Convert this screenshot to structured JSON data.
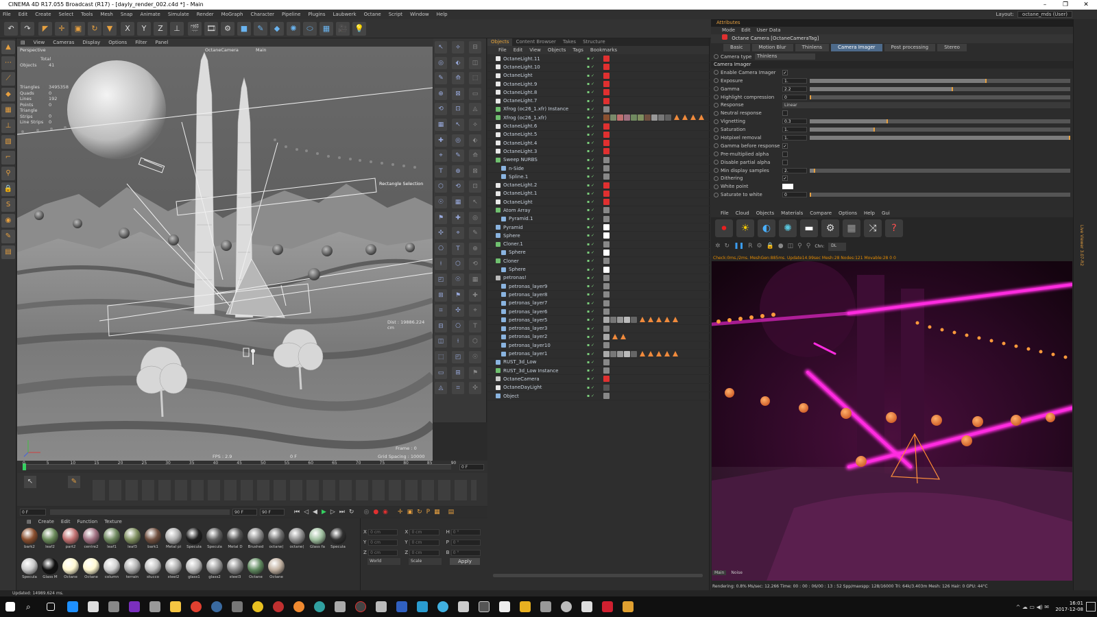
{
  "window": {
    "title": "CINEMA 4D R17.055 Broadcast (R17) - [dayly_render_002.c4d *] - Main",
    "controls": [
      "–",
      "❐",
      "✕"
    ]
  },
  "menubar": [
    "File",
    "Edit",
    "Create",
    "Select",
    "Tools",
    "Mesh",
    "Snap",
    "Animate",
    "Simulate",
    "Render",
    "MoGraph",
    "Character",
    "Pipeline",
    "Plugins",
    "Laubwerk",
    "Octane",
    "Script",
    "Window",
    "Help"
  ],
  "layout": {
    "label": "Layout:",
    "value": "octane_mds (User)"
  },
  "toolbar_icons": [
    "undo-icon",
    "redo-icon",
    "live-select-icon",
    "move-icon",
    "scale-icon",
    "rotate-icon",
    "recent-tools-icon",
    "x-axis-icon",
    "y-axis-icon",
    "z-axis-icon",
    "coordinate-system-icon",
    "render-view-icon",
    "render-picture-viewer-icon",
    "render-settings-icon",
    "cube-icon",
    "pen-icon",
    "subdivision-icon",
    "array-icon",
    "deformer-icon",
    "floor-icon",
    "camera-icon",
    "light-icon"
  ],
  "toolbar_glyphs": [
    "↶",
    "↷",
    "◤",
    "✛",
    "▣",
    "↻",
    "▼",
    "X",
    "Y",
    "Z",
    "⊥",
    "🎬",
    "🎞",
    "⚙",
    "■",
    "✎",
    "◆",
    "✺",
    "⬭",
    "▦",
    "🎥",
    "💡"
  ],
  "viewport": {
    "menu": [
      "View",
      "Cameras",
      "Display",
      "Options",
      "Filter",
      "Panel"
    ],
    "label": "Perspective",
    "camera_tag": "OctaneCamera",
    "main_tag": "Main",
    "stats_title": "Total",
    "stats": [
      {
        "k": "Objects",
        "v": "41"
      },
      {
        "k": "Triangles",
        "v": "3495358"
      },
      {
        "k": "Quads",
        "v": "0"
      },
      {
        "k": "Lines",
        "v": "192"
      },
      {
        "k": "Points",
        "v": "0"
      },
      {
        "k": "Triangle Strips",
        "v": "0"
      },
      {
        "k": "Line Strips",
        "v": "0"
      }
    ],
    "selection_label": "Rectangle Selection",
    "dist": "Dist : 19886.224 cm",
    "frame": "Frame : 0",
    "fps": "FPS : 2.9",
    "frame_mid": "0 F",
    "grid": "Grid Spacing : 10000 cm"
  },
  "object_manager": {
    "tabs": [
      "Objects",
      "Content Browser",
      "Takes",
      "Structure"
    ],
    "menu": [
      "File",
      "Edit",
      "View",
      "Objects",
      "Tags",
      "Bookmarks"
    ],
    "items": [
      {
        "name": "OctaneLight.11",
        "indent": 0,
        "color": "#e8e8e8"
      },
      {
        "name": "OctaneLight.10",
        "indent": 0,
        "color": "#e8e8e8"
      },
      {
        "name": "OctaneLight",
        "indent": 0,
        "color": "#e8e8e8"
      },
      {
        "name": "OctaneLight.9",
        "indent": 0,
        "color": "#e8e8e8"
      },
      {
        "name": "OctaneLight.8",
        "indent": 0,
        "color": "#e8e8e8"
      },
      {
        "name": "OctaneLight.7",
        "indent": 0,
        "color": "#e8e8e8"
      },
      {
        "name": "Xfrog (oc26_1.xfr) Instance",
        "indent": 0,
        "color": "#6fc06f"
      },
      {
        "name": "Xfrog (oc26_1.xfr)",
        "indent": 0,
        "color": "#6fc06f"
      },
      {
        "name": "OctaneLight.6",
        "indent": 0,
        "color": "#e8e8e8"
      },
      {
        "name": "OctaneLight.5",
        "indent": 0,
        "color": "#e8e8e8"
      },
      {
        "name": "OctaneLight.4",
        "indent": 0,
        "color": "#e8e8e8"
      },
      {
        "name": "OctaneLight.3",
        "indent": 0,
        "color": "#e8e8e8"
      },
      {
        "name": "Sweep NURBS",
        "indent": 0,
        "color": "#6fc06f"
      },
      {
        "name": "n-Side",
        "indent": 1,
        "color": "#8ab4e0"
      },
      {
        "name": "Spline.1",
        "indent": 1,
        "color": "#8ab4e0"
      },
      {
        "name": "OctaneLight.2",
        "indent": 0,
        "color": "#e8e8e8"
      },
      {
        "name": "OctaneLight.1",
        "indent": 0,
        "color": "#e8e8e8"
      },
      {
        "name": "OctaneLight",
        "indent": 0,
        "color": "#e8e8e8"
      },
      {
        "name": "Atom Array",
        "indent": 0,
        "color": "#6fc06f"
      },
      {
        "name": "Pyramid.1",
        "indent": 1,
        "color": "#8ab4e0"
      },
      {
        "name": "Pyramid",
        "indent": 0,
        "color": "#8ab4e0"
      },
      {
        "name": "Sphere",
        "indent": 0,
        "color": "#8ab4e0"
      },
      {
        "name": "Cloner.1",
        "indent": 0,
        "color": "#6fc06f"
      },
      {
        "name": "Sphere",
        "indent": 1,
        "color": "#8ab4e0"
      },
      {
        "name": "Cloner",
        "indent": 0,
        "color": "#6fc06f"
      },
      {
        "name": "Sphere",
        "indent": 1,
        "color": "#8ab4e0"
      },
      {
        "name": "petronas!",
        "indent": 0,
        "color": "#bbbbbb"
      },
      {
        "name": "petronas_layer9",
        "indent": 1,
        "color": "#8ab4e0"
      },
      {
        "name": "petronas_layer8",
        "indent": 1,
        "color": "#8ab4e0"
      },
      {
        "name": "petronas_layer7",
        "indent": 1,
        "color": "#8ab4e0"
      },
      {
        "name": "petronas_layer6",
        "indent": 1,
        "color": "#8ab4e0"
      },
      {
        "name": "petronas_layer5",
        "indent": 1,
        "color": "#8ab4e0"
      },
      {
        "name": "petronas_layer3",
        "indent": 1,
        "color": "#8ab4e0"
      },
      {
        "name": "petronas_layer2",
        "indent": 1,
        "color": "#8ab4e0"
      },
      {
        "name": "petronas_layer10",
        "indent": 1,
        "color": "#8ab4e0"
      },
      {
        "name": "petronas_layer1",
        "indent": 1,
        "color": "#8ab4e0"
      },
      {
        "name": "RUST_3d_Low",
        "indent": 0,
        "color": "#8ab4e0"
      },
      {
        "name": "RUST_3d_Low Instance",
        "indent": 0,
        "color": "#6fc06f"
      },
      {
        "name": "OctaneCamera",
        "indent": 0,
        "color": "#cccccc"
      },
      {
        "name": "OctaneDayLight",
        "indent": 0,
        "color": "#e8e8e8"
      },
      {
        "name": "Object",
        "indent": 0,
        "color": "#8ab4e0"
      }
    ]
  },
  "attributes": {
    "header": "Attributes",
    "menu": [
      "Mode",
      "Edit",
      "User Data"
    ],
    "object": "Octane Camera [OctaneCameraTag]",
    "tabs": [
      "Basic",
      "Motion Blur",
      "Thinlens",
      "Camera Imager",
      "Post processing",
      "Stereo"
    ],
    "active_tab": "Camera Imager",
    "camera_type_label": "Camera type",
    "camera_type": "Thinlens",
    "section": "Camera Imager",
    "rows": [
      {
        "label": "Enable Camera Imager",
        "value": "✓",
        "kind": "check"
      },
      {
        "label": "Exposure",
        "value": "1.",
        "kind": "slider",
        "fill": 0.68
      },
      {
        "label": "Gamma",
        "value": "2.2",
        "kind": "slider",
        "fill": 0.55
      },
      {
        "label": "Highlight compression",
        "value": "0",
        "kind": "slider",
        "fill": 0.0
      },
      {
        "label": "Response",
        "value": "Linear",
        "kind": "select"
      },
      {
        "label": "Neutral response",
        "value": "",
        "kind": "check"
      },
      {
        "label": "Vignetting",
        "value": "0.3",
        "kind": "slider",
        "fill": 0.3
      },
      {
        "label": "Saturation",
        "value": "1.",
        "kind": "slider",
        "fill": 0.25
      },
      {
        "label": "Hotpixel removal",
        "value": "1.",
        "kind": "slider",
        "fill": 1.0
      },
      {
        "label": "Gamma before response",
        "value": "✓",
        "kind": "check"
      },
      {
        "label": "Pre-multiplied alpha",
        "value": "",
        "kind": "check"
      },
      {
        "label": "Disable partial alpha",
        "value": "",
        "kind": "check"
      },
      {
        "label": "Min display samples",
        "value": "2.",
        "kind": "slider",
        "fill": 0.02
      },
      {
        "label": "Dithering",
        "value": "✓",
        "kind": "check"
      },
      {
        "label": "White point",
        "value": "",
        "kind": "color"
      },
      {
        "label": "Saturate to white",
        "value": "0",
        "kind": "slider",
        "fill": 0.0
      }
    ]
  },
  "octane": {
    "menu": [
      "File",
      "Cloud",
      "Objects",
      "Materials",
      "Compare",
      "Options",
      "Help",
      "Gui"
    ],
    "buttons": [
      {
        "icon": "record-icon",
        "glyph": "⏺",
        "color": "#e82020"
      },
      {
        "icon": "sun-icon",
        "glyph": "☀",
        "color": "#ffd000"
      },
      {
        "icon": "contrast-icon",
        "glyph": "◐",
        "color": "#4ab0ff"
      },
      {
        "icon": "octane-logo-icon",
        "glyph": "✺",
        "color": "#5ac8e0"
      },
      {
        "icon": "white-bar-icon",
        "glyph": "▬",
        "color": "#ffffff"
      },
      {
        "icon": "settings-icon",
        "glyph": "⚙",
        "color": "#dddddd"
      },
      {
        "icon": "grid-icon",
        "glyph": "▦",
        "color": "#999999"
      },
      {
        "icon": "shuffle-icon",
        "glyph": "⤨",
        "color": "#dddddd"
      },
      {
        "icon": "help-icon",
        "glyph": "?",
        "color": "#ff5050"
      }
    ],
    "channel_label": "Chn:",
    "channel": "DL",
    "info": "Check:0ms./2ms. MeshGen:885ms. Update14.99sec Mesh:28 Nodes:121 Movable:28  0 0",
    "tabs": [
      "Main",
      "Noise"
    ],
    "status": "Rendering: 0.8%   Ms/sec: 12.266   Time: 00 : 00 : 06/00 : 13 : 52   Spp/maxspp: 128/16000   Tri: 64k/3.403m   Mesh: 126   Hair: 0   GPU:   44°C"
  },
  "timeline": {
    "ticks": [
      "0",
      "5",
      "10",
      "15",
      "20",
      "25",
      "30",
      "35",
      "40",
      "45",
      "50",
      "55",
      "60",
      "65",
      "70",
      "75",
      "80",
      "85",
      "90"
    ],
    "current": "0 F",
    "start": "0 F",
    "end": "90 F",
    "end2": "90 F"
  },
  "materials": {
    "menu": [
      "Create",
      "Edit",
      "Function",
      "Texture"
    ],
    "row1": [
      {
        "n": "bark2",
        "c": "#8a5030"
      },
      {
        "n": "leaf2",
        "c": "#6a8a5a"
      },
      {
        "n": "part2",
        "c": "#c07070"
      },
      {
        "n": "centre2",
        "c": "#a07080"
      },
      {
        "n": "leaf1",
        "c": "#708a60"
      },
      {
        "n": "leaf3",
        "c": "#809060"
      },
      {
        "n": "bark1",
        "c": "#705040"
      },
      {
        "n": "Metal pi",
        "c": "#b0b0b0"
      },
      {
        "n": "Specula",
        "c": "#202020"
      },
      {
        "n": "Specula",
        "c": "#606060"
      },
      {
        "n": "Metal D",
        "c": "#555"
      },
      {
        "n": "Brushed",
        "c": "#8a8a8a"
      },
      {
        "n": "octane(",
        "c": "#707070"
      },
      {
        "n": "octane(",
        "c": "#909090"
      },
      {
        "n": "Glass fa",
        "c": "#a0c0a0"
      },
      {
        "n": "Specula",
        "c": "#303030"
      }
    ],
    "row2": [
      {
        "n": "Specula",
        "c": "#c8c8c8"
      },
      {
        "n": "Glass M",
        "c": "#111"
      },
      {
        "n": "Octane",
        "c": "#fff8d0"
      },
      {
        "n": "Octane",
        "c": "#fff8d0"
      },
      {
        "n": "column",
        "c": "#d0d0d0"
      },
      {
        "n": "terrain",
        "c": "#b0b0b0"
      },
      {
        "n": "stucco",
        "c": "#c0c0c0"
      },
      {
        "n": "steel2",
        "c": "#aaaaaa"
      },
      {
        "n": "glass1",
        "c": "#bbbbbb"
      },
      {
        "n": "glass2",
        "c": "#999999"
      },
      {
        "n": "steel3",
        "c": "#8a8a8a"
      },
      {
        "n": "Octane",
        "c": "#608a60"
      },
      {
        "n": "Octane",
        "c": "#c0b0a0"
      }
    ]
  },
  "coords": {
    "rows": [
      [
        "X",
        "0 cm",
        "X",
        "0 cm",
        "H",
        "0 °"
      ],
      [
        "Y",
        "0 cm",
        "Y",
        "0 cm",
        "P",
        "0 °"
      ],
      [
        "Z",
        "0 cm",
        "Z",
        "0 cm",
        "B",
        "0 °"
      ]
    ],
    "mode1": "World",
    "mode2": "Scale",
    "apply": "Apply"
  },
  "right_strip": "Live Viewer 3.07-R2",
  "status": "Updated: 14989.624 ms.",
  "taskbar": {
    "time": "16:01",
    "date": "2017-12-08"
  },
  "colors": {
    "accent": "#e6a040",
    "octane_render_magenta": "#ff2ce0",
    "orange_sphere": "#f08a3c"
  }
}
